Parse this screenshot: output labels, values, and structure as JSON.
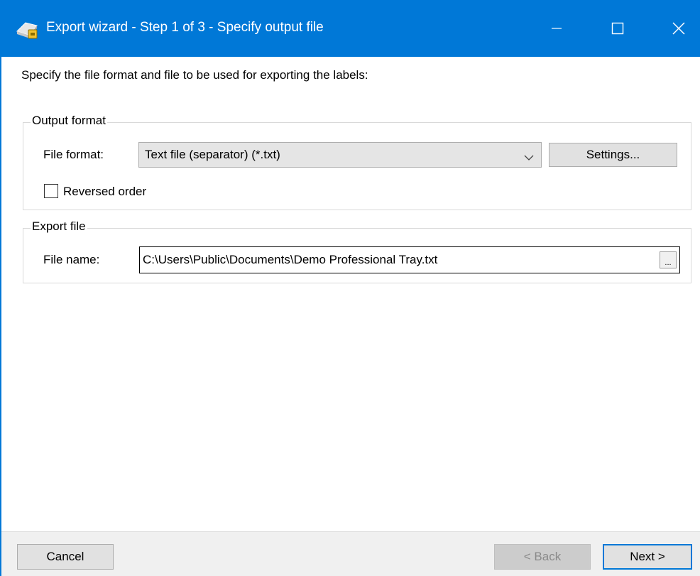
{
  "window": {
    "title": "Export wizard - Step 1 of 3 - Specify output file",
    "accent_color": "#0078d7",
    "icons": {
      "app": "label-printer-icon",
      "minimize": "minimize-icon",
      "maximize": "maximize-icon",
      "close": "close-icon"
    }
  },
  "instruction": "Specify the file format and file to be used for exporting the labels:",
  "output_format": {
    "legend": "Output format",
    "file_format_label": "File format:",
    "file_format_value": "Text file (separator) (*.txt)",
    "settings_button": "Settings...",
    "reversed_order_label": "Reversed order",
    "reversed_order_checked": false
  },
  "export_file": {
    "legend": "Export file",
    "file_name_label": "File name:",
    "file_name_value": "C:\\Users\\Public\\Documents\\Demo Professional Tray.txt",
    "browse_button": "..."
  },
  "footer": {
    "cancel": "Cancel",
    "back": "< Back",
    "back_enabled": false,
    "next": "Next >"
  }
}
